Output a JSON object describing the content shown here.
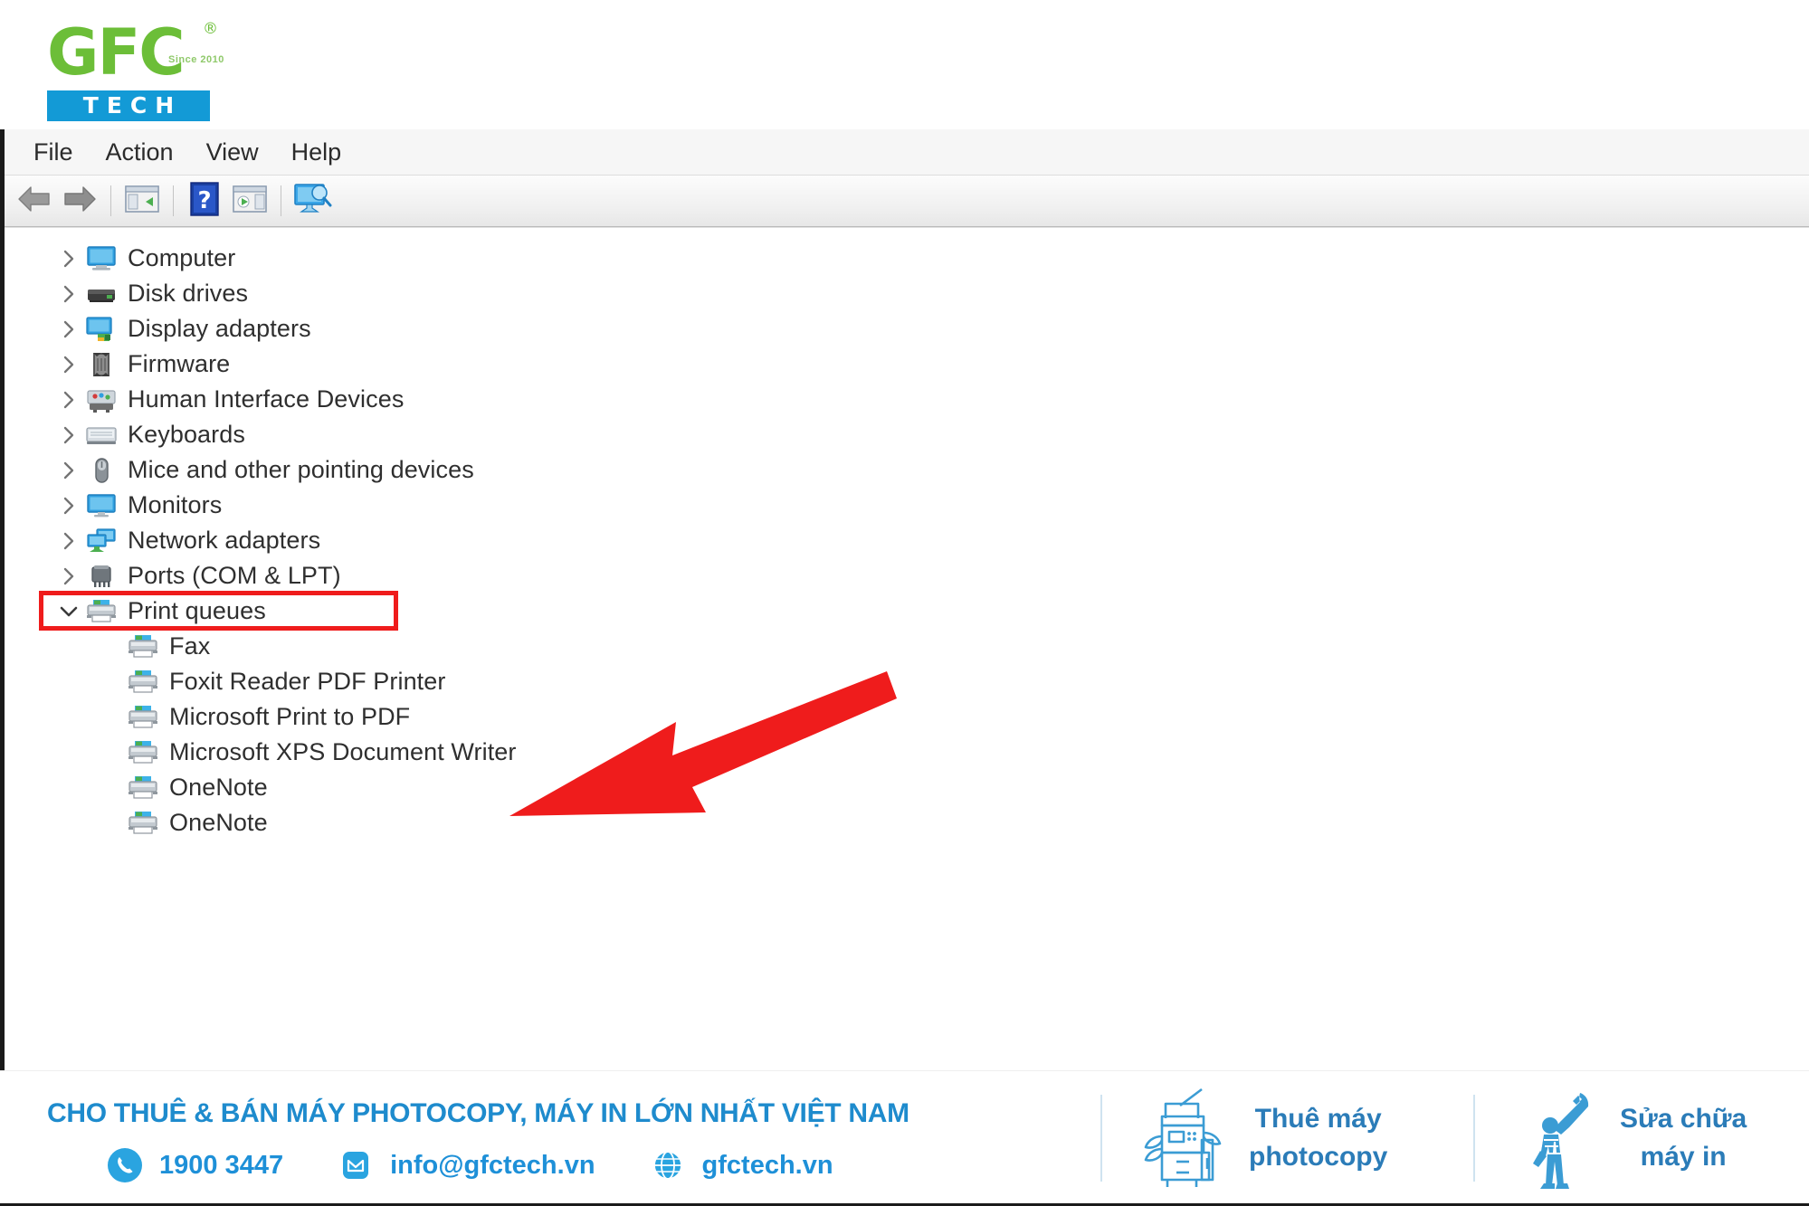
{
  "logo": {
    "brand": "GFC",
    "registered": "®",
    "since": "Since 2010",
    "sub": "TECH"
  },
  "window": {
    "menu": [
      {
        "label": "File",
        "name": "menu-file"
      },
      {
        "label": "Action",
        "name": "menu-action"
      },
      {
        "label": "View",
        "name": "menu-view"
      },
      {
        "label": "Help",
        "name": "menu-help"
      }
    ],
    "toolbar": [
      {
        "icon": "back-arrow-icon"
      },
      {
        "icon": "forward-arrow-icon"
      },
      {
        "icon": "separator"
      },
      {
        "icon": "show-hide-console-tree-icon"
      },
      {
        "icon": "separator"
      },
      {
        "icon": "help-icon"
      },
      {
        "icon": "properties-icon"
      },
      {
        "icon": "separator"
      },
      {
        "icon": "scan-for-hardware-changes-icon"
      }
    ]
  },
  "tree": {
    "items": [
      {
        "label": "Computer",
        "icon": "computer-icon",
        "expander": "collapsed",
        "level": 0
      },
      {
        "label": "Disk drives",
        "icon": "disk-drive-icon",
        "expander": "collapsed",
        "level": 0
      },
      {
        "label": "Display adapters",
        "icon": "display-adapter-icon",
        "expander": "collapsed",
        "level": 0
      },
      {
        "label": "Firmware",
        "icon": "firmware-icon",
        "expander": "collapsed",
        "level": 0
      },
      {
        "label": "Human Interface Devices",
        "icon": "hid-icon",
        "expander": "collapsed",
        "level": 0
      },
      {
        "label": "Keyboards",
        "icon": "keyboard-icon",
        "expander": "collapsed",
        "level": 0
      },
      {
        "label": "Mice and other pointing devices",
        "icon": "mouse-icon",
        "expander": "collapsed",
        "level": 0
      },
      {
        "label": "Monitors",
        "icon": "monitor-icon",
        "expander": "collapsed",
        "level": 0
      },
      {
        "label": "Network adapters",
        "icon": "network-adapter-icon",
        "expander": "collapsed",
        "level": 0
      },
      {
        "label": "Ports (COM & LPT)",
        "icon": "port-icon",
        "expander": "collapsed",
        "level": 0
      },
      {
        "label": "Print queues",
        "icon": "printer-icon",
        "expander": "expanded",
        "level": 0,
        "highlighted": true
      },
      {
        "label": "Fax",
        "icon": "printer-icon",
        "expander": "none",
        "level": 1
      },
      {
        "label": "Foxit Reader PDF Printer",
        "icon": "printer-icon",
        "expander": "none",
        "level": 1
      },
      {
        "label": "Microsoft Print to PDF",
        "icon": "printer-icon",
        "expander": "none",
        "level": 1
      },
      {
        "label": "Microsoft XPS Document Writer",
        "icon": "printer-icon",
        "expander": "none",
        "level": 1
      },
      {
        "label": "OneNote",
        "icon": "printer-icon",
        "expander": "none",
        "level": 1
      },
      {
        "label": "OneNote",
        "icon": "printer-icon",
        "expander": "none",
        "level": 1
      }
    ]
  },
  "annotation": {
    "highlight_color": "#ef1c1c",
    "arrow_color": "#ef1c1c",
    "target_label": "Print queues"
  },
  "footer": {
    "headline": "CHO THUÊ & BÁN MÁY PHOTOCOPY, MÁY IN LỚN NHẤT VIỆT NAM",
    "phone": "1900 3447",
    "email": "info@gfctech.vn",
    "website": "gfctech.vn",
    "phone_icon": "phone-icon",
    "email_icon": "envelope-icon",
    "web_icon": "globe-icon",
    "services": [
      {
        "line1": "Thuê máy",
        "line2": "photocopy",
        "icon": "copier-icon"
      },
      {
        "line1": "Sửa chữa",
        "line2": "máy in",
        "icon": "technician-wrench-icon"
      }
    ],
    "accent": "#1e8bcd"
  }
}
